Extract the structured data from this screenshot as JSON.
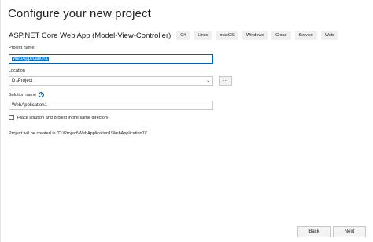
{
  "page": {
    "title": "Configure your new project"
  },
  "template": {
    "name": "ASP.NET Core Web App (Model-View-Controller)",
    "tags": [
      "C#",
      "Linux",
      "macOS",
      "Windows",
      "Cloud",
      "Service",
      "Web"
    ]
  },
  "project_name": {
    "label": "Project name",
    "value": "WebApplication1"
  },
  "location": {
    "label": "Location",
    "value": "D:\\Project",
    "browse_label": "..."
  },
  "solution_name": {
    "label": "Solution name",
    "value": "WebApplication1"
  },
  "same_directory": {
    "label": "Place solution and project in the same directory",
    "checked": false
  },
  "info": {
    "text": "Project will be created in \"D:\\Project\\WebApplication1\\WebApplication1\\\""
  },
  "footer": {
    "back_label": "Back",
    "next_label": "Next"
  },
  "colors": {
    "accent": "#005fb8",
    "selection": "#0078d7",
    "tag_bg": "#efeff2"
  }
}
